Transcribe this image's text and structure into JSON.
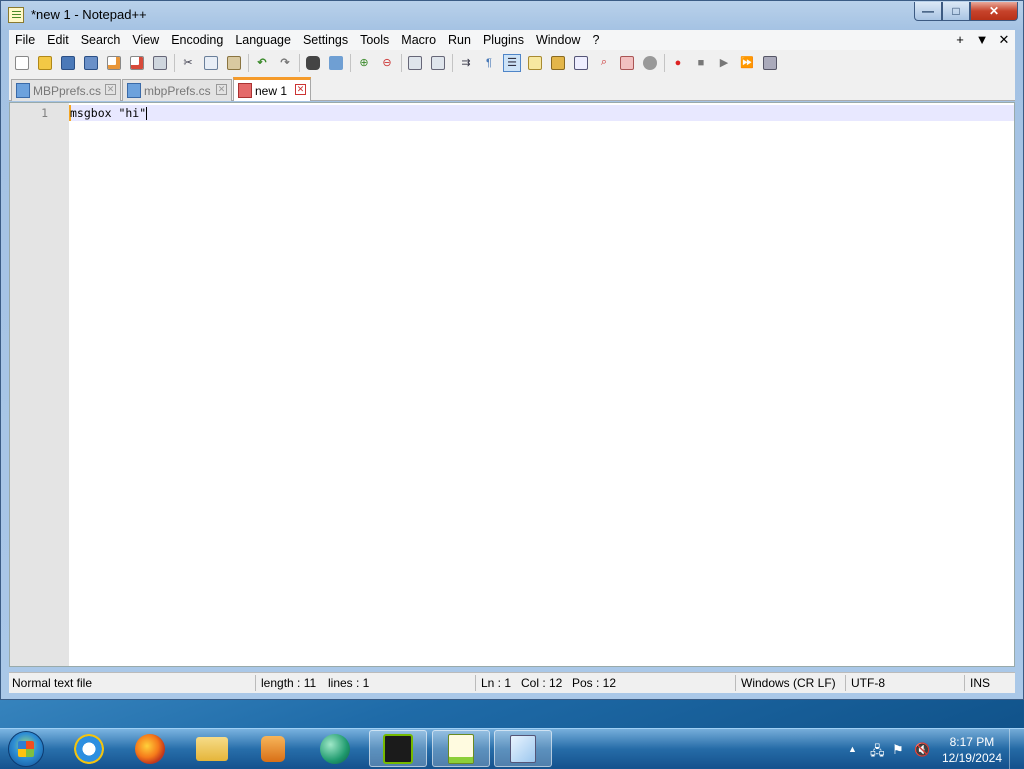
{
  "window": {
    "title": "*new 1 - Notepad++",
    "controls": {
      "minimize": "—",
      "maximize": "□",
      "close": "✕"
    }
  },
  "menu": {
    "items": [
      "File",
      "Edit",
      "Search",
      "View",
      "Encoding",
      "Language",
      "Settings",
      "Tools",
      "Macro",
      "Run",
      "Plugins",
      "Window",
      "?"
    ],
    "right": [
      "+",
      "▼",
      "✕"
    ]
  },
  "toolbar": {
    "icons": [
      "new-file",
      "open-file",
      "save",
      "save-all",
      "close",
      "close-all",
      "print",
      "cut",
      "copy",
      "paste",
      "undo",
      "redo",
      "find",
      "replace",
      "zoom-in",
      "zoom-out",
      "sync-vertical",
      "sync-horizontal",
      "word-wrap",
      "show-all-characters",
      "indent-guide",
      "user-defined-language",
      "document-map",
      "function-list",
      "folder-as-workspace",
      "monitoring",
      "record-macro",
      "stop-recording",
      "playback-macro",
      "run-macro-multiple",
      "save-macro"
    ]
  },
  "tabs": [
    {
      "label": "MBPprefs.cs",
      "active": false
    },
    {
      "label": "mbpPrefs.cs",
      "active": false
    },
    {
      "label": "new 1",
      "active": true
    }
  ],
  "editor": {
    "line_number": "1",
    "content": "msgbox \"hi\""
  },
  "status": {
    "file_type": "Normal text file",
    "length": "length : 11",
    "lines": "lines : 1",
    "ln": "Ln : 1",
    "col": "Col : 12",
    "pos": "Pos : 12",
    "eol": "Windows (CR LF)",
    "encoding": "UTF-8",
    "mode": "INS"
  },
  "taskbar": {
    "apps": [
      "internet-explorer",
      "firefox",
      "windows-explorer",
      "media-player",
      "messenger",
      "nvidia",
      "notepad-plus-plus",
      "notepad"
    ],
    "active_app": "notepad-plus-plus",
    "clock_time": "8:17 PM",
    "clock_date": "12/19/2024",
    "tray_chevron": "▲"
  },
  "colors": {
    "accent": "#f59b2b",
    "current_line": "#e8e8ff",
    "gutter": "#e4e4e4"
  }
}
